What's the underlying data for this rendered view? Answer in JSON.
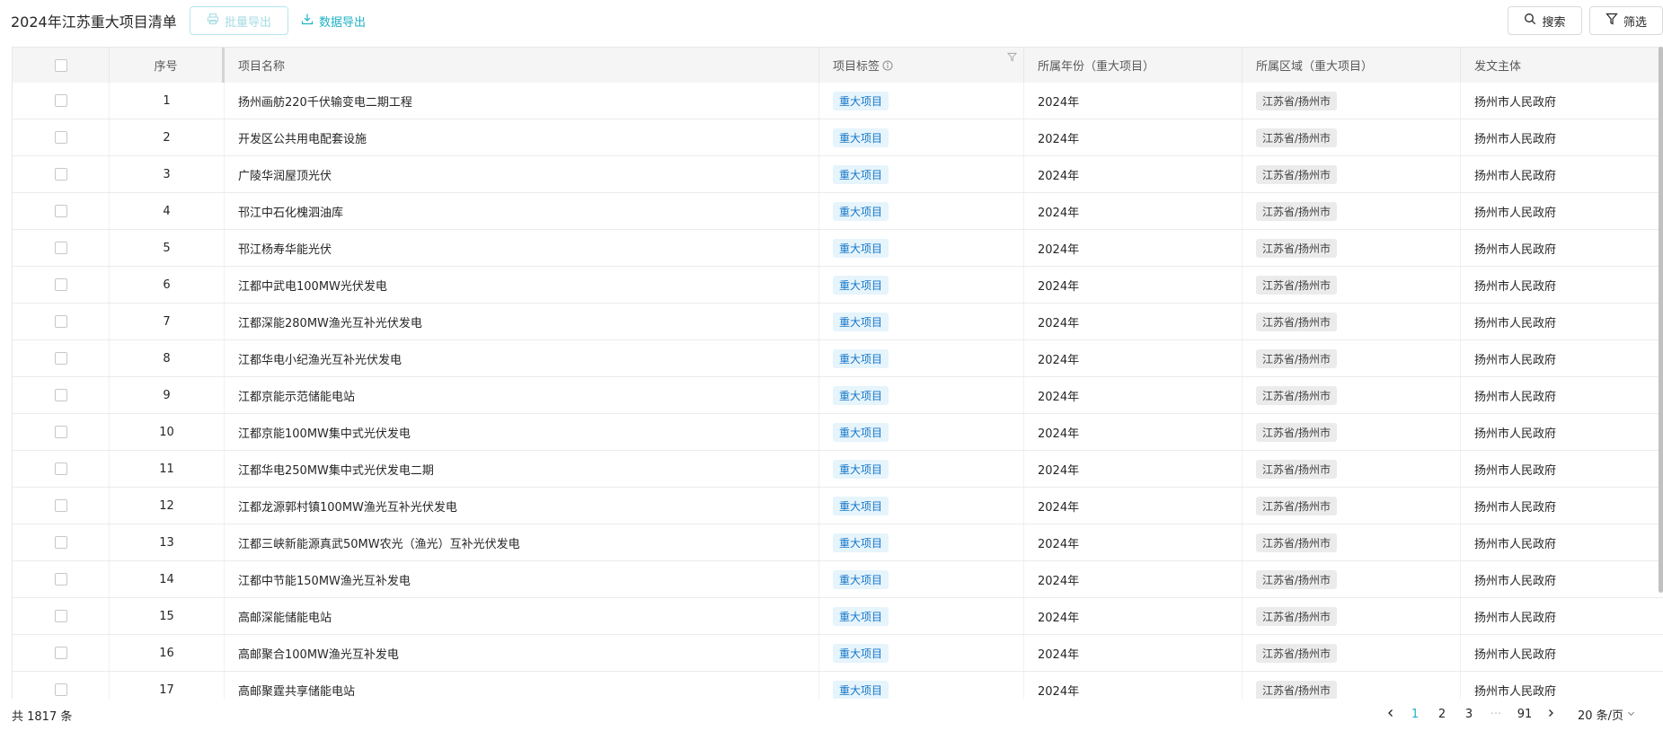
{
  "toolbar": {
    "title": "2024年江苏重大项目清单",
    "batch_export_label": "批量导出",
    "data_export_label": "数据导出",
    "search_label": "搜索",
    "filter_label": "筛选"
  },
  "table": {
    "columns": [
      "序号",
      "项目名称",
      "项目标签",
      "所属年份（重大项目）",
      "所属区域（重大项目）",
      "发文主体"
    ],
    "rows": [
      {
        "no": "1",
        "name": "扬州画舫220千伏输变电二期工程",
        "tag": "重大项目",
        "year": "2024年",
        "region": "江苏省/扬州市",
        "issuer": "扬州市人民政府"
      },
      {
        "no": "2",
        "name": "开发区公共用电配套设施",
        "tag": "重大项目",
        "year": "2024年",
        "region": "江苏省/扬州市",
        "issuer": "扬州市人民政府"
      },
      {
        "no": "3",
        "name": "广陵华润屋顶光伏",
        "tag": "重大项目",
        "year": "2024年",
        "region": "江苏省/扬州市",
        "issuer": "扬州市人民政府"
      },
      {
        "no": "4",
        "name": "邗江中石化槐泗油库",
        "tag": "重大项目",
        "year": "2024年",
        "region": "江苏省/扬州市",
        "issuer": "扬州市人民政府"
      },
      {
        "no": "5",
        "name": "邗江杨寿华能光伏",
        "tag": "重大项目",
        "year": "2024年",
        "region": "江苏省/扬州市",
        "issuer": "扬州市人民政府"
      },
      {
        "no": "6",
        "name": "江都中武电100MW光伏发电",
        "tag": "重大项目",
        "year": "2024年",
        "region": "江苏省/扬州市",
        "issuer": "扬州市人民政府"
      },
      {
        "no": "7",
        "name": "江都深能280MW渔光互补光伏发电",
        "tag": "重大项目",
        "year": "2024年",
        "region": "江苏省/扬州市",
        "issuer": "扬州市人民政府"
      },
      {
        "no": "8",
        "name": "江都华电小纪渔光互补光伏发电",
        "tag": "重大项目",
        "year": "2024年",
        "region": "江苏省/扬州市",
        "issuer": "扬州市人民政府"
      },
      {
        "no": "9",
        "name": "江都京能示范储能电站",
        "tag": "重大项目",
        "year": "2024年",
        "region": "江苏省/扬州市",
        "issuer": "扬州市人民政府"
      },
      {
        "no": "10",
        "name": "江都京能100MW集中式光伏发电",
        "tag": "重大项目",
        "year": "2024年",
        "region": "江苏省/扬州市",
        "issuer": "扬州市人民政府"
      },
      {
        "no": "11",
        "name": "江都华电250MW集中式光伏发电二期",
        "tag": "重大项目",
        "year": "2024年",
        "region": "江苏省/扬州市",
        "issuer": "扬州市人民政府"
      },
      {
        "no": "12",
        "name": "江都龙源郭村镇100MW渔光互补光伏发电",
        "tag": "重大项目",
        "year": "2024年",
        "region": "江苏省/扬州市",
        "issuer": "扬州市人民政府"
      },
      {
        "no": "13",
        "name": "江都三峡新能源真武50MW农光（渔光）互补光伏发电",
        "tag": "重大项目",
        "year": "2024年",
        "region": "江苏省/扬州市",
        "issuer": "扬州市人民政府"
      },
      {
        "no": "14",
        "name": "江都中节能150MW渔光互补发电",
        "tag": "重大项目",
        "year": "2024年",
        "region": "江苏省/扬州市",
        "issuer": "扬州市人民政府"
      },
      {
        "no": "15",
        "name": "高邮深能储能电站",
        "tag": "重大项目",
        "year": "2024年",
        "region": "江苏省/扬州市",
        "issuer": "扬州市人民政府"
      },
      {
        "no": "16",
        "name": "高邮聚合100MW渔光互补发电",
        "tag": "重大项目",
        "year": "2024年",
        "region": "江苏省/扬州市",
        "issuer": "扬州市人民政府"
      },
      {
        "no": "17",
        "name": "高邮聚霆共享储能电站",
        "tag": "重大项目",
        "year": "2024年",
        "region": "江苏省/扬州市",
        "issuer": "扬州市人民政府"
      }
    ]
  },
  "footer": {
    "total_label": "共 1817 条",
    "pages": [
      "1",
      "2",
      "3"
    ],
    "ellipsis": "···",
    "last_page": "91",
    "current_page": "1",
    "page_size_label": "20 条/页"
  },
  "icons": {
    "batch_export": "printer-icon",
    "data_export": "download-icon",
    "search": "search-icon",
    "filter": "funnel-icon",
    "column_info": "info-icon",
    "column_filter": "funnel-icon",
    "prev": "chevron-left-icon",
    "next": "chevron-right-icon",
    "page_size": "chevron-down-icon"
  },
  "colors": {
    "accent": "#1fb3c4",
    "disabled_accent": "#a6dce3",
    "tag_blue_bg": "#e6f4fc",
    "tag_blue_text": "#1677c8",
    "tag_gray_bg": "#ebebeb",
    "header_bg": "#f5f5f5"
  }
}
